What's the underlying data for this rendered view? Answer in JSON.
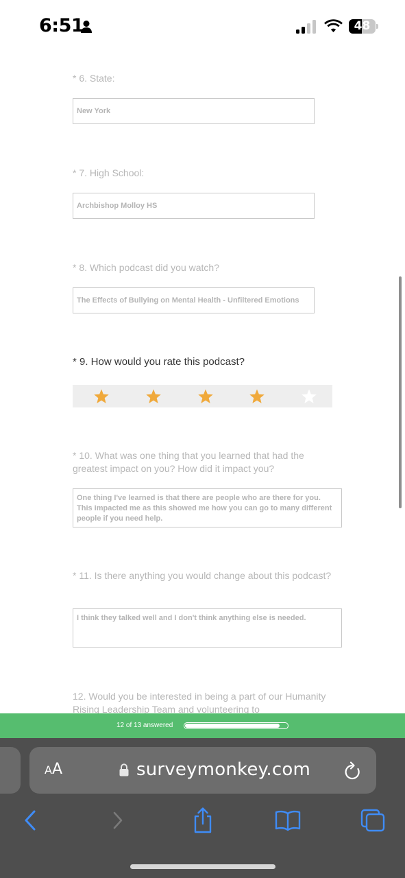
{
  "status_bar": {
    "time": "6:51",
    "battery_level": "48",
    "icons": [
      "person-icon",
      "signal-icon",
      "wifi-icon",
      "battery-icon"
    ]
  },
  "survey": {
    "questions": [
      {
        "label": "* 6. State:",
        "answer": "New York"
      },
      {
        "label": "* 7. High School:",
        "answer": "Archbishop Molloy HS"
      },
      {
        "label": "* 8. Which podcast did you watch?",
        "answer": "The Effects of Bullying on Mental Health - Unfiltered Emotions"
      },
      {
        "label": "* 9. How would you rate this podcast?",
        "rating": 4,
        "rating_max": 5
      },
      {
        "label": "* 10. What was one thing that you learned that had the greatest impact on you? How did it impact you?",
        "answer": "One thing I've learned is that there are people who are there for you. This impacted me as this showed me how you can go to many different people if you need help."
      },
      {
        "label": "* 11. Is there anything you would change about this podcast?",
        "answer": "I think they talked well and I don't think anything else is needed."
      },
      {
        "label": "12. Would you be interested in being a part of our Humanity Rising Leadership Team and volunteering to"
      }
    ],
    "star_color": "#f0a93b"
  },
  "progress": {
    "text": "12 of 13 answered",
    "answered": 12,
    "total": 13
  },
  "browser": {
    "aa_small": "A",
    "aa_big": "A",
    "url": "surveymonkey.com",
    "toolbar_icons": [
      "back-icon",
      "forward-icon",
      "share-icon",
      "bookmarks-icon",
      "tabs-icon"
    ]
  },
  "colors": {
    "progress_green": "#56bd6f",
    "browser_accent": "#3f8cf7"
  }
}
